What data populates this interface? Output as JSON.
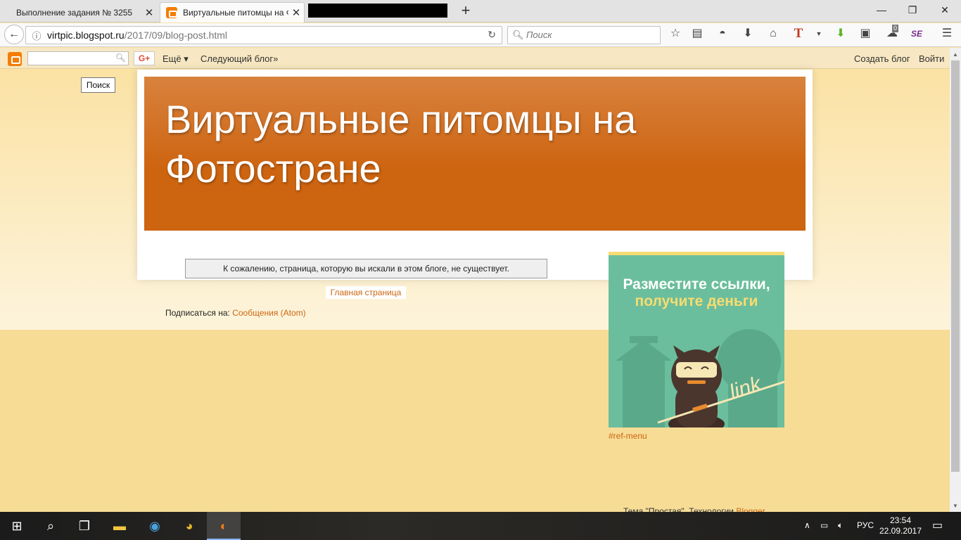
{
  "browser": {
    "tabs": [
      {
        "title": "Выполнение задания № 3255",
        "active": false
      },
      {
        "title": "Виртуальные питомцы на Ф",
        "active": true
      }
    ],
    "new_tab": "+",
    "url_host": "virtpic.blogspot.ru",
    "url_path": "/2017/09/blog-post.html",
    "search_placeholder": "Поиск",
    "badge_count": "0"
  },
  "blogger_bar": {
    "gplus": "G+",
    "more": "Ещё ▾",
    "next_blog": "Следующий блог»",
    "create_blog": "Создать блог",
    "login": "Войти"
  },
  "page": {
    "search_tooltip": "Поиск",
    "title": "Виртуальные питомцы на Фотостране",
    "status_message": "К сожалению, страница, которую вы искали в этом блоге, не существует.",
    "home_link": "Главная страница",
    "subscribe_label": "Подписаться на:",
    "subscribe_link": "Сообщения (Atom)",
    "ad_line1": "Разместите ссылки,",
    "ad_line2": "получите деньги",
    "ad_art_text": "link",
    "ref_menu": "#ref-menu",
    "footer_text": "Тема \"Простая\". Технологии ",
    "footer_link": "Blogger"
  },
  "taskbar": {
    "language": "РУС",
    "time": "23:54",
    "date": "22.09.2017"
  },
  "colors": {
    "accent": "#cc6611",
    "header_orange": "#cd6410",
    "page_bg": "#f7dc96"
  }
}
